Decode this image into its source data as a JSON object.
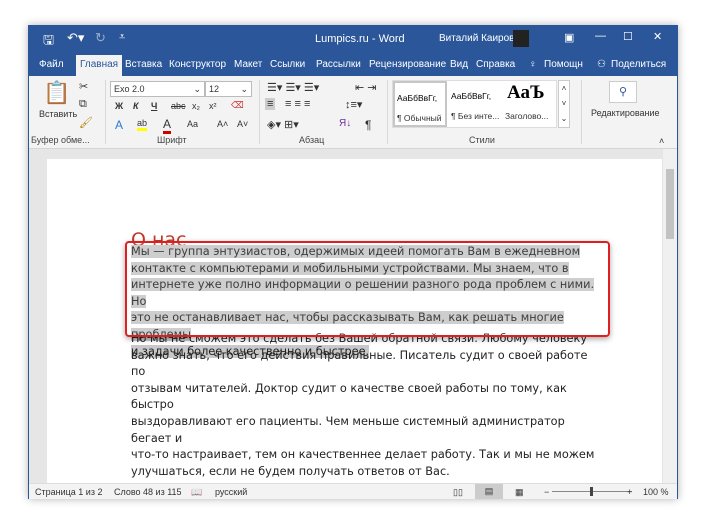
{
  "window": {
    "title": "Lumpics.ru  -  Word",
    "user": "Виталий Каиров"
  },
  "tabs": [
    "Файл",
    "Главная",
    "Вставка",
    "Конструктор",
    "Макет",
    "Ссылки",
    "Рассылки",
    "Рецензирование",
    "Вид",
    "Справка",
    "Помощн",
    "Поделиться"
  ],
  "ribbon": {
    "paste": "Вставить",
    "font_name": "Exo 2.0",
    "font_size": "12",
    "bold": "Ж",
    "italic": "К",
    "underline": "Ч",
    "strike": "abc",
    "sub": "x₂",
    "sup": "x²",
    "case": "Aa",
    "grow": "A˄",
    "shrink": "A˅",
    "pilcrow": "¶",
    "styles": [
      {
        "preview": "АаБбВвГг,",
        "name": "¶ Обычный"
      },
      {
        "preview": "АаБбВвГг,",
        "name": "¶ Без инте..."
      },
      {
        "preview": "АаЪ",
        "name": "Заголово..."
      }
    ],
    "editing": "Редактирование",
    "groups": {
      "clipboard": "Буфер обме...",
      "font": "Шрифт",
      "paragraph": "Абзац",
      "styles": "Стили"
    }
  },
  "document": {
    "heading": "О нас",
    "selected_lines": [
      "Мы — группа энтузиастов, одержимых идеей помогать Вам в ежедневном",
      "контакте с компьютерами и мобильными устройствами. Мы знаем, что в",
      "интернете уже полно информации о решении разного рода проблем с ними. Но",
      "это не останавливает нас, чтобы рассказывать Вам, как решать многие проблемы",
      "и задачи более качественно и быстрее."
    ],
    "lines": [
      "Но мы не сможем это сделать без Вашей обратной связи. Любому человеку",
      "важно знать, что его действия правильные. Писатель судит о своей работе по",
      "отзывам читателей. Доктор судит о качестве своей работы по тому, как быстро",
      "выздоравливают его пациенты. Чем меньше системный администратор бегает и",
      "что-то настраивает, тем он качественнее делает работу. Так и мы не можем",
      "улучшаться, если не будем получать ответов от Вас."
    ]
  },
  "status": {
    "page": "Страница 1 из 2",
    "words": "Слово 48 из 115",
    "language": "русский",
    "zoom": "100 %",
    "zoom_level_percent": 100
  },
  "colors": {
    "accent": "#2b579a",
    "heading": "#c0392b",
    "highlight_border": "#e02020"
  }
}
